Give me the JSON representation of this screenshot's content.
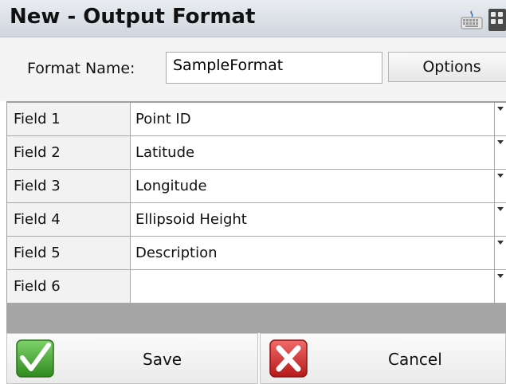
{
  "window": {
    "title": "New - Output Format"
  },
  "icons": {
    "keyboard": "keyboard-icon",
    "calculator": "calculator-icon",
    "save": "checkmark-icon",
    "cancel": "x-icon"
  },
  "format": {
    "label": "Format Name:",
    "value": "SampleFormat",
    "options_label": "Options"
  },
  "fields": [
    {
      "name": "Field 1",
      "value": "Point ID"
    },
    {
      "name": "Field 2",
      "value": "Latitude"
    },
    {
      "name": "Field 3",
      "value": "Longitude"
    },
    {
      "name": "Field 4",
      "value": "Ellipsoid Height"
    },
    {
      "name": "Field 5",
      "value": "Description"
    },
    {
      "name": "Field 6",
      "value": ""
    }
  ],
  "actions": {
    "save_label": "Save",
    "cancel_label": "Cancel"
  },
  "colors": {
    "save_green": "#3c9a2a",
    "cancel_red": "#d02626",
    "band_gray": "#a6a6a6"
  }
}
